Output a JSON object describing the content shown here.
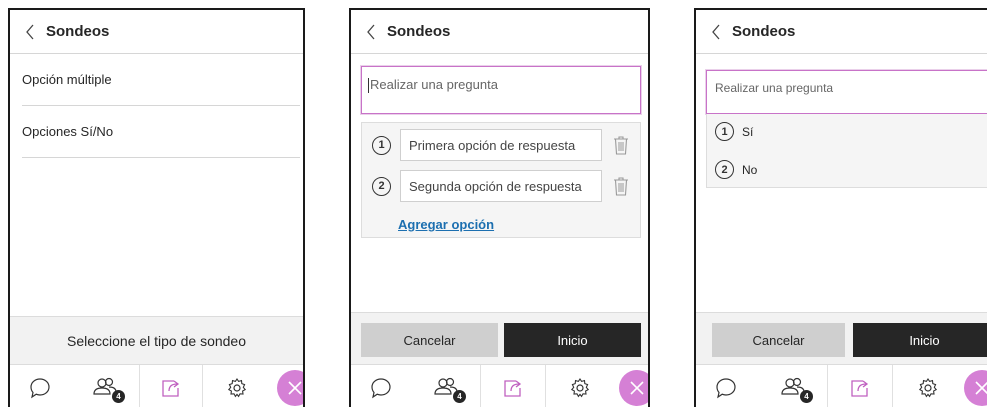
{
  "header": {
    "title": "Sondeos"
  },
  "panel1": {
    "types": [
      "Opción múltiple",
      "Opciones Sí/No"
    ],
    "select_prompt": "Seleccione el tipo de sondeo"
  },
  "panel2": {
    "question_placeholder": "Realizar una pregunta",
    "options": [
      {
        "number": "1",
        "placeholder": "Primera opción de respuesta"
      },
      {
        "number": "2",
        "placeholder": "Segunda opción de respuesta"
      }
    ],
    "add_option": "Agregar opción"
  },
  "panel3": {
    "question_placeholder": "Realizar una pregunta",
    "options": [
      {
        "number": "1",
        "label": "Sí"
      },
      {
        "number": "2",
        "label": "No"
      }
    ]
  },
  "buttons": {
    "cancel": "Cancelar",
    "start": "Inicio"
  },
  "nav": {
    "attendees_badge": "4"
  },
  "colors": {
    "accent": "#d580d5",
    "link": "#1c6fb0",
    "dark": "#262626"
  }
}
